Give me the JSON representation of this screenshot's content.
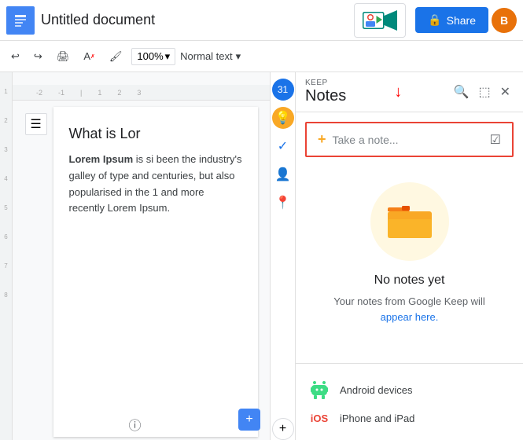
{
  "toolbar": {
    "docs_label": "Google Docs",
    "undo_label": "↩",
    "redo_label": "↪",
    "print_label": "🖨",
    "paint_label": "A",
    "format_label": "🖌",
    "zoom": "100%",
    "zoom_arrow": "▾",
    "normal_text": "Normal text",
    "share_label": "Share",
    "avatar_label": "B",
    "meet_label": "Meet"
  },
  "keep": {
    "keep_label": "KEEP",
    "notes_title": "Notes",
    "take_note_placeholder": "Take a note...",
    "no_notes_title": "No notes yet",
    "no_notes_desc_1": "Your notes from Google Keep will",
    "no_notes_desc_2": "appear here.",
    "device_android": "Android devices",
    "device_ios": "iPhone and iPad",
    "ios_label": "iOS"
  },
  "document": {
    "heading": "What is Lor",
    "paragraph": " is si been the industry's galley of type and centuries, but also popularised in the 1 and more recently Lorem Ipsum.",
    "bold_start": "Lorem Ipsum"
  }
}
